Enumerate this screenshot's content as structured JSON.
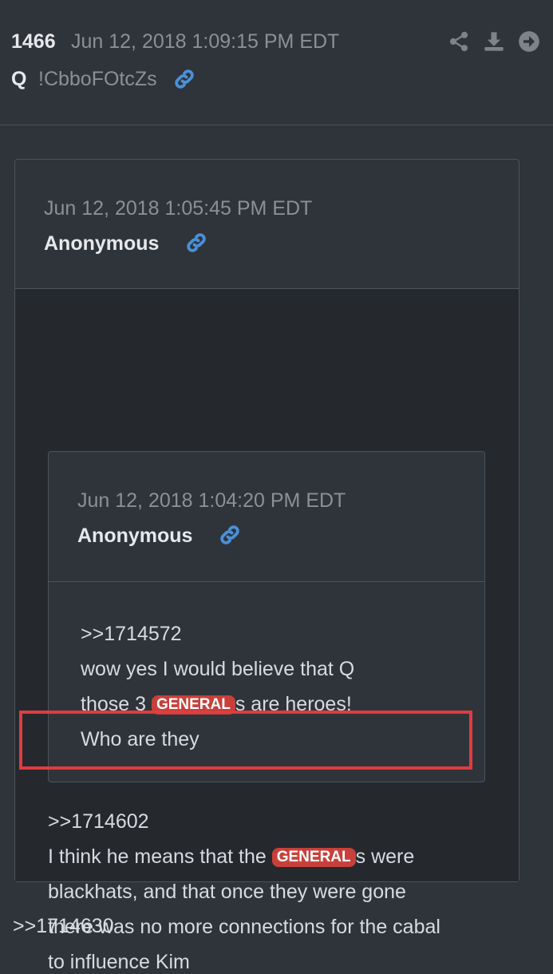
{
  "post": {
    "number": "1466",
    "timestamp": "Jun 12, 2018 1:09:15 PM EDT",
    "author": "Q",
    "tripcode": "!CbboFOtcZs"
  },
  "quote_outer": {
    "timestamp": "Jun 12, 2018 1:05:45 PM EDT",
    "author": "Anonymous",
    "ref": ">>1714602",
    "line1_pre": "I think he means that the ",
    "tag": "GENERAL",
    "line1_post": "s were",
    "line2": "blackhats, and that once they were gone",
    "line3": "there was no more connections for the cabal",
    "line4": "to influence Kim"
  },
  "quote_inner": {
    "timestamp": "Jun 12, 2018 1:04:20 PM EDT",
    "author": "Anonymous",
    "ref": ">>1714572",
    "line1": "wow yes I would believe that Q",
    "line2_pre": "those 3 ",
    "tag": "GENERAL",
    "line2_post": "s are heroes!",
    "line3": "Who are they"
  },
  "footer_ref": ">>1714630",
  "colors": {
    "background": "#2f343a",
    "tag": "#c8403a",
    "link": "#4a90d9",
    "highlight": "#e03c3f"
  },
  "icons": [
    "link-icon",
    "share-icon",
    "download-icon",
    "arrow-right-circle-icon"
  ]
}
